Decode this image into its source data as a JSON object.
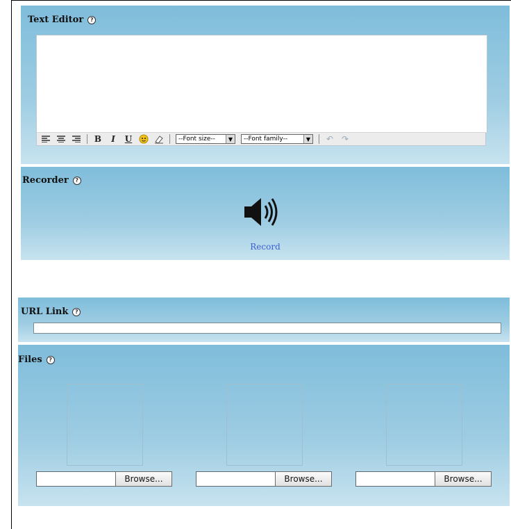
{
  "text_editor": {
    "title": "Text Editor",
    "help": "?",
    "toolbar": {
      "bold": "B",
      "italic": "I",
      "underline": "U",
      "font_size": "--Font size--",
      "font_family": "--Font family--"
    }
  },
  "recorder": {
    "title": "Recorder",
    "help": "?",
    "record_label": "Record"
  },
  "url_link": {
    "title": "URL Link",
    "help": "?",
    "value": ""
  },
  "files": {
    "title": "Files",
    "help": "?",
    "browse_label": "Browse..."
  }
}
